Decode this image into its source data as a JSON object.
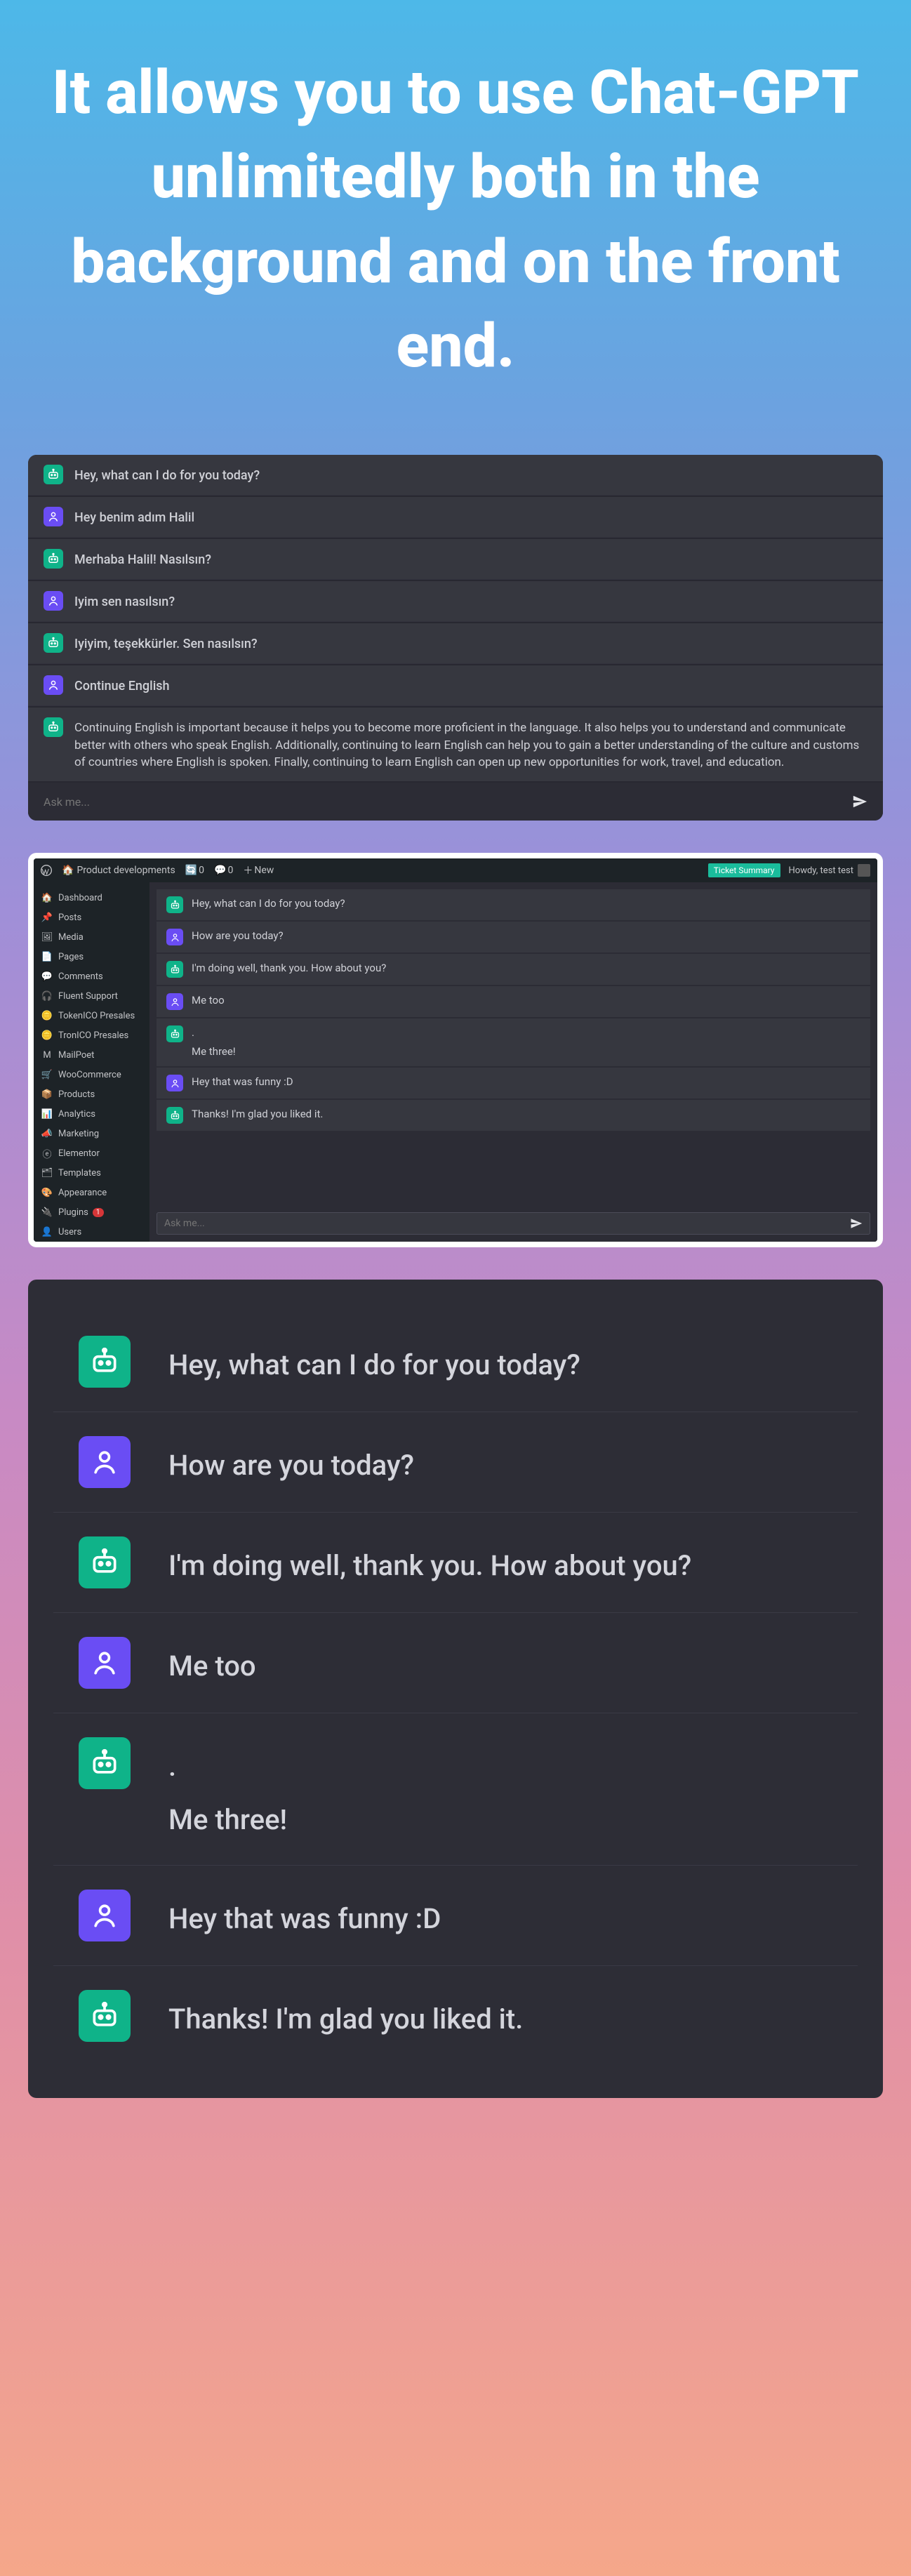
{
  "hero": {
    "title": "It allows you to use Chat-GPT unlimitedly both in the background and on the front end."
  },
  "front_chat": {
    "rows": [
      {
        "role": "bot",
        "text": "Hey, what can I do for you today?"
      },
      {
        "role": "user",
        "text": "Hey benim adım Halil"
      },
      {
        "role": "bot",
        "text": "Merhaba Halil! Nasılsın?"
      },
      {
        "role": "user",
        "text": "Iyim sen nasılsın?"
      },
      {
        "role": "bot",
        "text": "Iyiyim, teşekkürler. Sen nasılsın?"
      },
      {
        "role": "user",
        "text": "Continue English"
      },
      {
        "role": "bot",
        "text": "Continuing English is important because it helps you to become more proficient in the language. It also helps you to understand and communicate better with others who speak English. Additionally, continuing to learn English can help you to gain a better understanding of the culture and customs of countries where English is spoken. Finally, continuing to learn English can open up new opportunities for work, travel, and education."
      }
    ],
    "input_placeholder": "Ask me..."
  },
  "wp": {
    "adminbar": {
      "site_name": "Product developments",
      "comments_count": "0",
      "new_label": "New",
      "ticket_badge": "Ticket Summary",
      "howdy": "Howdy, test test"
    },
    "sidebar": [
      {
        "icon": "🏠",
        "label": "Dashboard"
      },
      {
        "icon": "📌",
        "label": "Posts"
      },
      {
        "icon": "🖼",
        "label": "Media"
      },
      {
        "icon": "📄",
        "label": "Pages"
      },
      {
        "icon": "💬",
        "label": "Comments"
      },
      {
        "icon": "🎧",
        "label": "Fluent Support"
      },
      {
        "icon": "🪙",
        "label": "TokenICO Presales"
      },
      {
        "icon": "🪙",
        "label": "TronICO Presales"
      },
      {
        "icon": "M",
        "label": "MailPoet"
      },
      {
        "icon": "🛒",
        "label": "WooCommerce"
      },
      {
        "icon": "📦",
        "label": "Products"
      },
      {
        "icon": "📊",
        "label": "Analytics"
      },
      {
        "icon": "📣",
        "label": "Marketing"
      },
      {
        "icon": "ⓔ",
        "label": "Elementor"
      },
      {
        "icon": "🗂",
        "label": "Templates"
      },
      {
        "icon": "🎨",
        "label": "Appearance"
      },
      {
        "icon": "🔌",
        "label": "Plugins",
        "badge": "1"
      },
      {
        "icon": "👤",
        "label": "Users"
      }
    ],
    "chat_rows": [
      {
        "role": "bot",
        "text": "Hey, what can I do for you today?"
      },
      {
        "role": "user",
        "text": "How are you today?"
      },
      {
        "role": "bot",
        "text": "I'm doing well, thank you. How about you?"
      },
      {
        "role": "user",
        "text": "Me too"
      },
      {
        "role": "bot",
        "text_a": ".",
        "text_b": "Me three!"
      },
      {
        "role": "user",
        "text": "Hey that was funny :D"
      },
      {
        "role": "bot",
        "text": "Thanks! I'm glad you liked it."
      }
    ],
    "input_placeholder": "Ask me..."
  },
  "big_chat": {
    "rows": [
      {
        "role": "bot",
        "text": "Hey, what can I do for you today?"
      },
      {
        "role": "user",
        "text": "How are you today?"
      },
      {
        "role": "bot",
        "text": "I'm doing well, thank you. How about you?"
      },
      {
        "role": "user",
        "text": "Me too"
      },
      {
        "role": "bot",
        "text_a": ".",
        "text_b": "Me three!"
      },
      {
        "role": "user",
        "text": "Hey that was funny :D"
      },
      {
        "role": "bot",
        "text": "Thanks! I'm glad you liked it."
      }
    ]
  },
  "colors": {
    "bot_avatar": "#0fb389",
    "user_avatar": "#6a4df4",
    "panel_bg": "#2c2c35"
  }
}
